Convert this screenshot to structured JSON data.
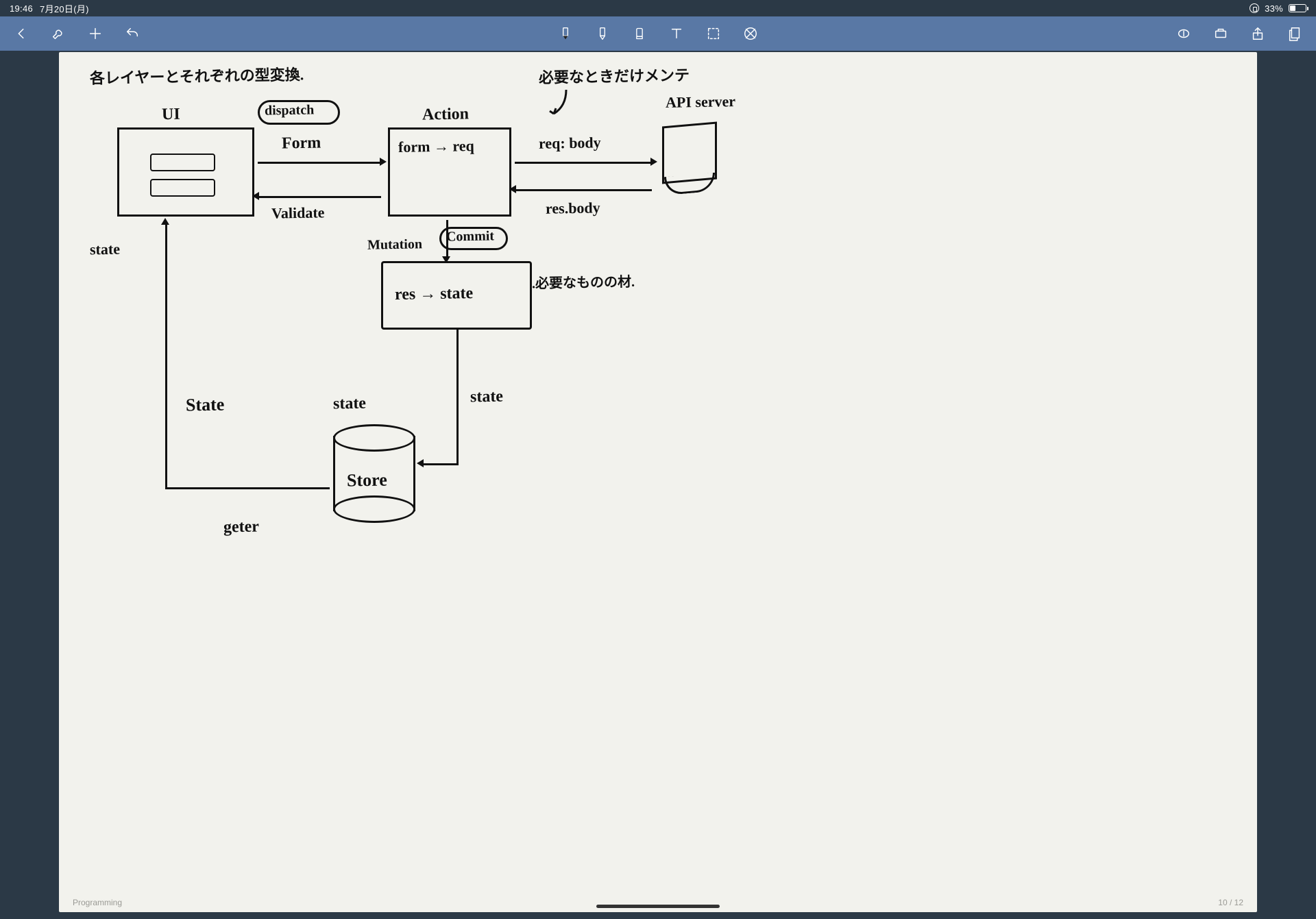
{
  "status": {
    "time": "19:46",
    "date": "7月20日(月)",
    "battery_pct_text": "33%",
    "battery_fill_pct": 33
  },
  "toolbar": {
    "back": "back",
    "wrench": "settings",
    "add": "add",
    "undo": "undo",
    "pen": "pen",
    "highlighter": "highlighter",
    "eraser": "eraser",
    "text": "text",
    "lasso": "selection",
    "geometry": "shape-assist",
    "lasso_insert": "insert-cutout",
    "trash_insert": "insert-space",
    "share": "share",
    "pages": "pages"
  },
  "footer": {
    "notebook": "Programming",
    "page_indicator": "10 / 12"
  },
  "diagram": {
    "title": "各レイヤーとそれぞれの型変換.",
    "note_top_right": "必要なときだけメンテ",
    "note_mid_right": ".必要なものの材.",
    "ui_label": "UI",
    "dispatch": "dispatch",
    "form": "Form",
    "validate": "Validate",
    "action_label": "Action",
    "action_body": "form → req",
    "req_body": "req: body",
    "res_body": "res.body",
    "api_server": "API server",
    "mutation": "Mutation",
    "commit": "Commit",
    "mutation_body": "res → state",
    "state_left": "state",
    "state_arrow_mid": "State",
    "state_near_store": "state",
    "state_right_vert": "state",
    "store_label": "Store",
    "getter": "geter"
  }
}
